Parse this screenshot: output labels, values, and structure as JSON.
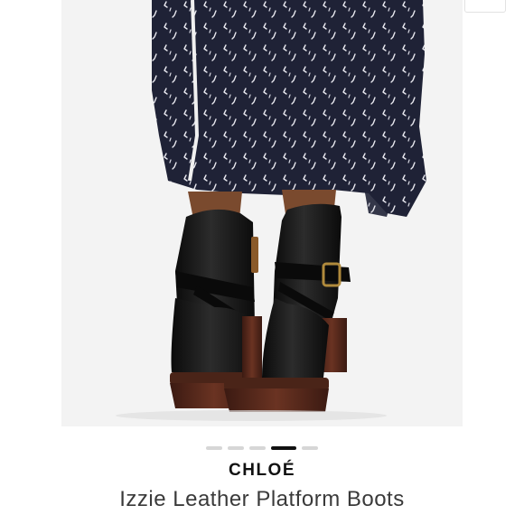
{
  "product": {
    "brand": "CHLOÉ",
    "name": "Izzie Leather Platform Boots",
    "image_alt": "Izzie Leather Platform Boots"
  },
  "carousel": {
    "total": 5,
    "active_index": 3
  },
  "colors": {
    "dress": "#1f2236",
    "boot_leather": "#141414",
    "heel_wood": "#4a2418",
    "skin": "#7a4a2e",
    "buckle": "#b08a3c",
    "dot_inactive": "#d6d6d6",
    "dot_active": "#111111"
  }
}
